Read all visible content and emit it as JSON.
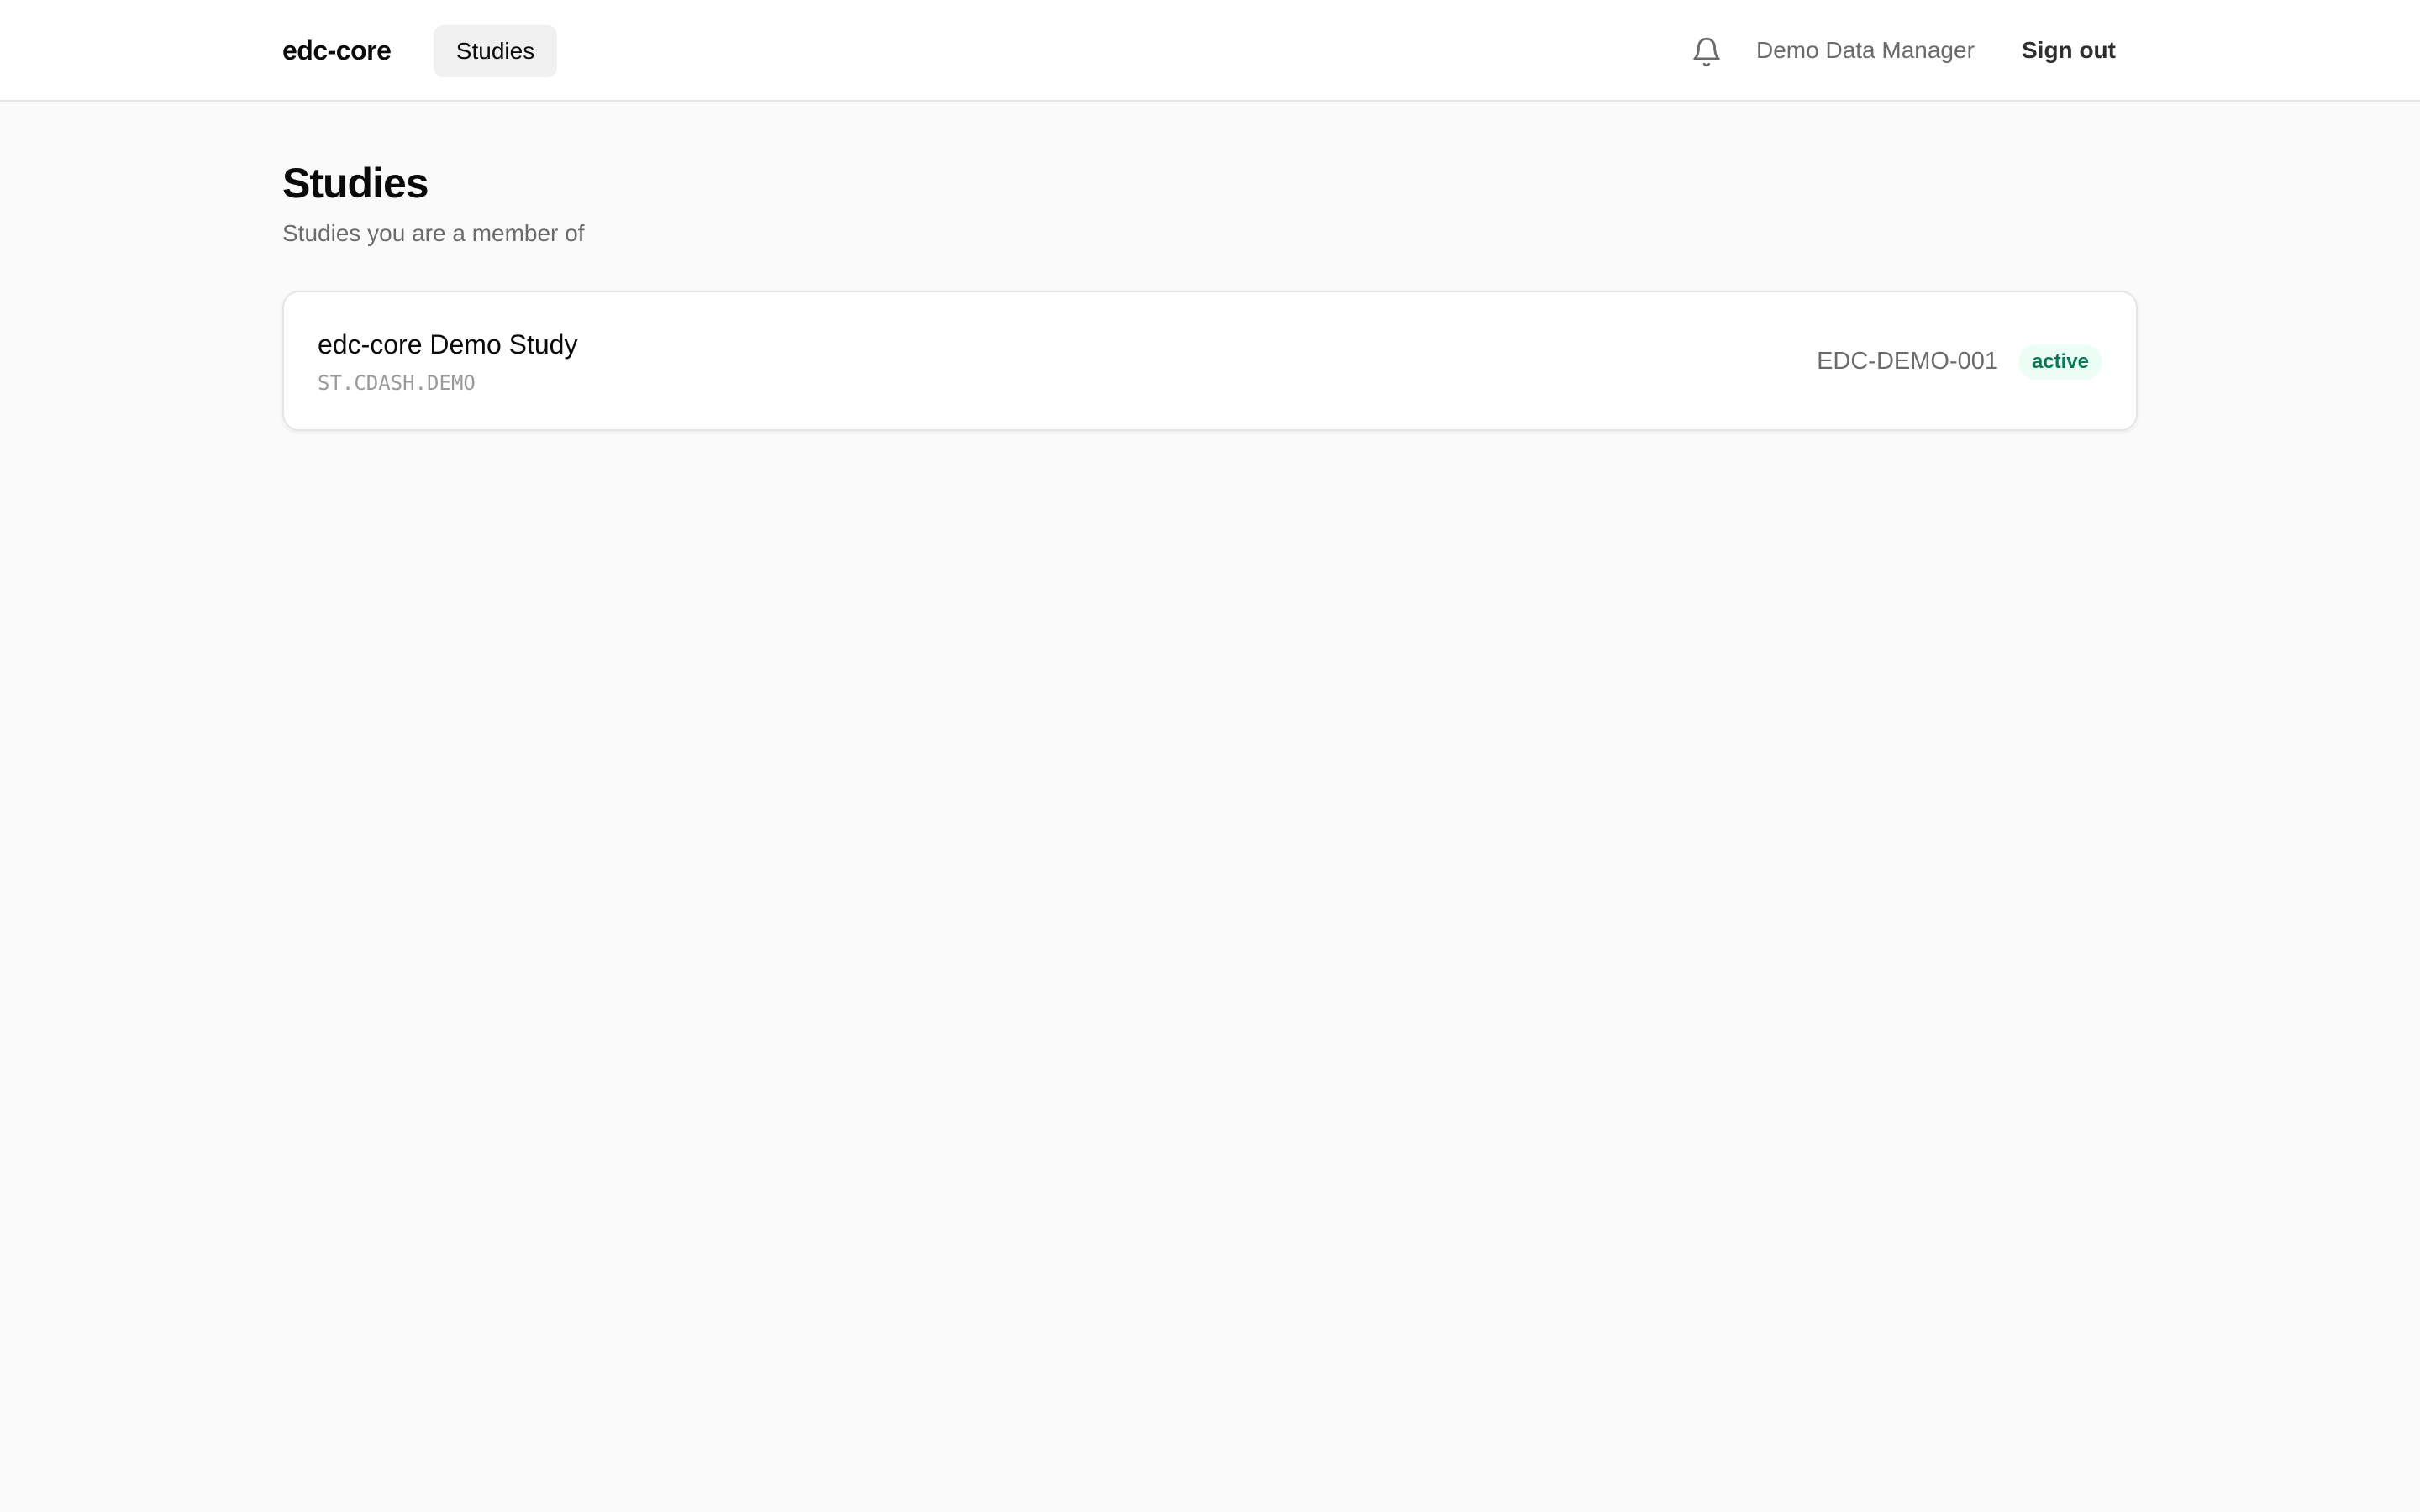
{
  "app": {
    "brand": "edc-core"
  },
  "header": {
    "nav": [
      {
        "label": "Studies",
        "active": true
      }
    ],
    "notifications_icon": "bell-icon",
    "user_name": "Demo Data Manager",
    "sign_out_label": "Sign out"
  },
  "main": {
    "title": "Studies",
    "subtitle": "Studies you are a member of",
    "studies": [
      {
        "name": "edc-core Demo Study",
        "code": "ST.CDASH.DEMO",
        "protocol": "EDC-DEMO-001",
        "status": "active"
      }
    ]
  },
  "colors": {
    "background": "#fafafa",
    "surface": "#ffffff",
    "border": "#e5e5e5",
    "nav_active_bg": "#f0f0f0",
    "muted_text": "#6b6b6b",
    "status_active_bg": "#ecfdf5",
    "status_active_text": "#047857"
  }
}
